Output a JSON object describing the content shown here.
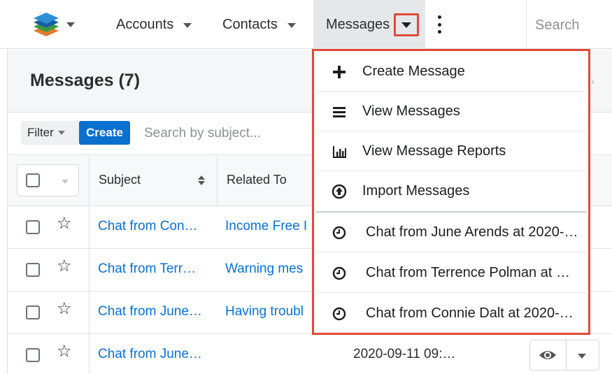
{
  "nav": {
    "logo": "sugar-cube-logo",
    "items": [
      {
        "label": "Accounts"
      },
      {
        "label": "Contacts"
      },
      {
        "label": "Messages"
      }
    ],
    "search_placeholder": "Search"
  },
  "page": {
    "title": "Messages (7)"
  },
  "filter_bar": {
    "filter_label": "Filter",
    "create_label": "Create",
    "search_placeholder": "Search by subject..."
  },
  "table": {
    "columns": [
      "Subject",
      "Related To"
    ],
    "rows": [
      {
        "subject": "Chat from Con…",
        "related_to": "Income Free I",
        "date": ""
      },
      {
        "subject": "Chat from Terr…",
        "related_to": "Warning mes",
        "date": ""
      },
      {
        "subject": "Chat from June…",
        "related_to": "Having troubl",
        "date": ""
      },
      {
        "subject": "Chat from June…",
        "related_to": "",
        "date": "2020-09-11 09:…"
      }
    ]
  },
  "dropdown": {
    "actions": [
      {
        "label": "Create Message",
        "icon": "plus-icon"
      },
      {
        "label": "View Messages",
        "icon": "list-icon"
      },
      {
        "label": "View Message Reports",
        "icon": "bar-chart-icon"
      },
      {
        "label": "Import Messages",
        "icon": "upload-circle-icon"
      }
    ],
    "recent": [
      {
        "label": "Chat from June Arends at 2020-…",
        "icon": "clock-icon"
      },
      {
        "label": "Chat from Terrence Polman at …",
        "icon": "clock-icon"
      },
      {
        "label": "Chat from Connie Dalt at 2020-…",
        "icon": "clock-icon"
      }
    ]
  },
  "colors": {
    "link": "#0a70cf",
    "highlight_border": "#e2493b",
    "create_button": "#0a70cf"
  }
}
